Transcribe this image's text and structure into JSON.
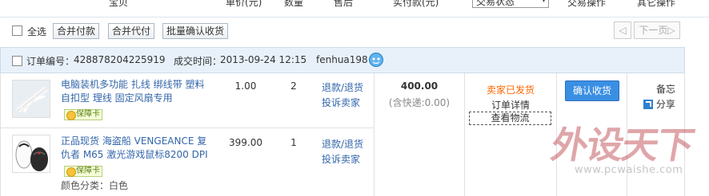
{
  "header": {
    "col_product": "宝贝",
    "col_price": "单价(元)",
    "col_qty": "数量",
    "col_after_sale": "售后",
    "col_paid": "实付款(元)",
    "status_select": "交易状态",
    "col_ops": "交易操作",
    "col_other": "其它操作"
  },
  "toolbar": {
    "select_all": "全选",
    "merge_pay": "合并付款",
    "merge_proxy_pay": "合并代付",
    "batch_confirm": "批量确认收货",
    "prev": "◁",
    "next_page": "下一页▷"
  },
  "order": {
    "number_label": "订单编号：",
    "number": "428878204225919",
    "time_label": "成交时间：",
    "time": "2013-09-24 12:15",
    "seller": "fenhua198",
    "total": "400.00",
    "shipping_note": "(含快递:0.00)",
    "status": "卖家已发货",
    "detail_link": "订单详情",
    "logistics_link": "查看物流",
    "confirm_button": "确认收货",
    "memo": "备忘",
    "share": "分享",
    "items": [
      {
        "title": "电脑装机多功能 扎线 绑线带 塑料自扣型 理线 固定风扇专用",
        "guarantee": "保障卡",
        "price": "1.00",
        "qty": "2",
        "refund": "退款/退货",
        "complain": "投诉卖家",
        "variant": ""
      },
      {
        "title": "正品现货 海盗船 VENGEANCE 复仇者 M65 激光游戏鼠标8200 DPI",
        "guarantee": "保障卡",
        "price": "399.00",
        "qty": "1",
        "refund": "退款/退货",
        "complain": "投诉卖家",
        "variant": "颜色分类：白色"
      }
    ]
  },
  "watermark": {
    "brand": "外设天下",
    "url": "www.pcwaishe.com"
  },
  "colors": {
    "accent_blue": "#3a8fe3",
    "status_orange": "#ff6600",
    "order_header_bg": "#e8f1fa"
  }
}
